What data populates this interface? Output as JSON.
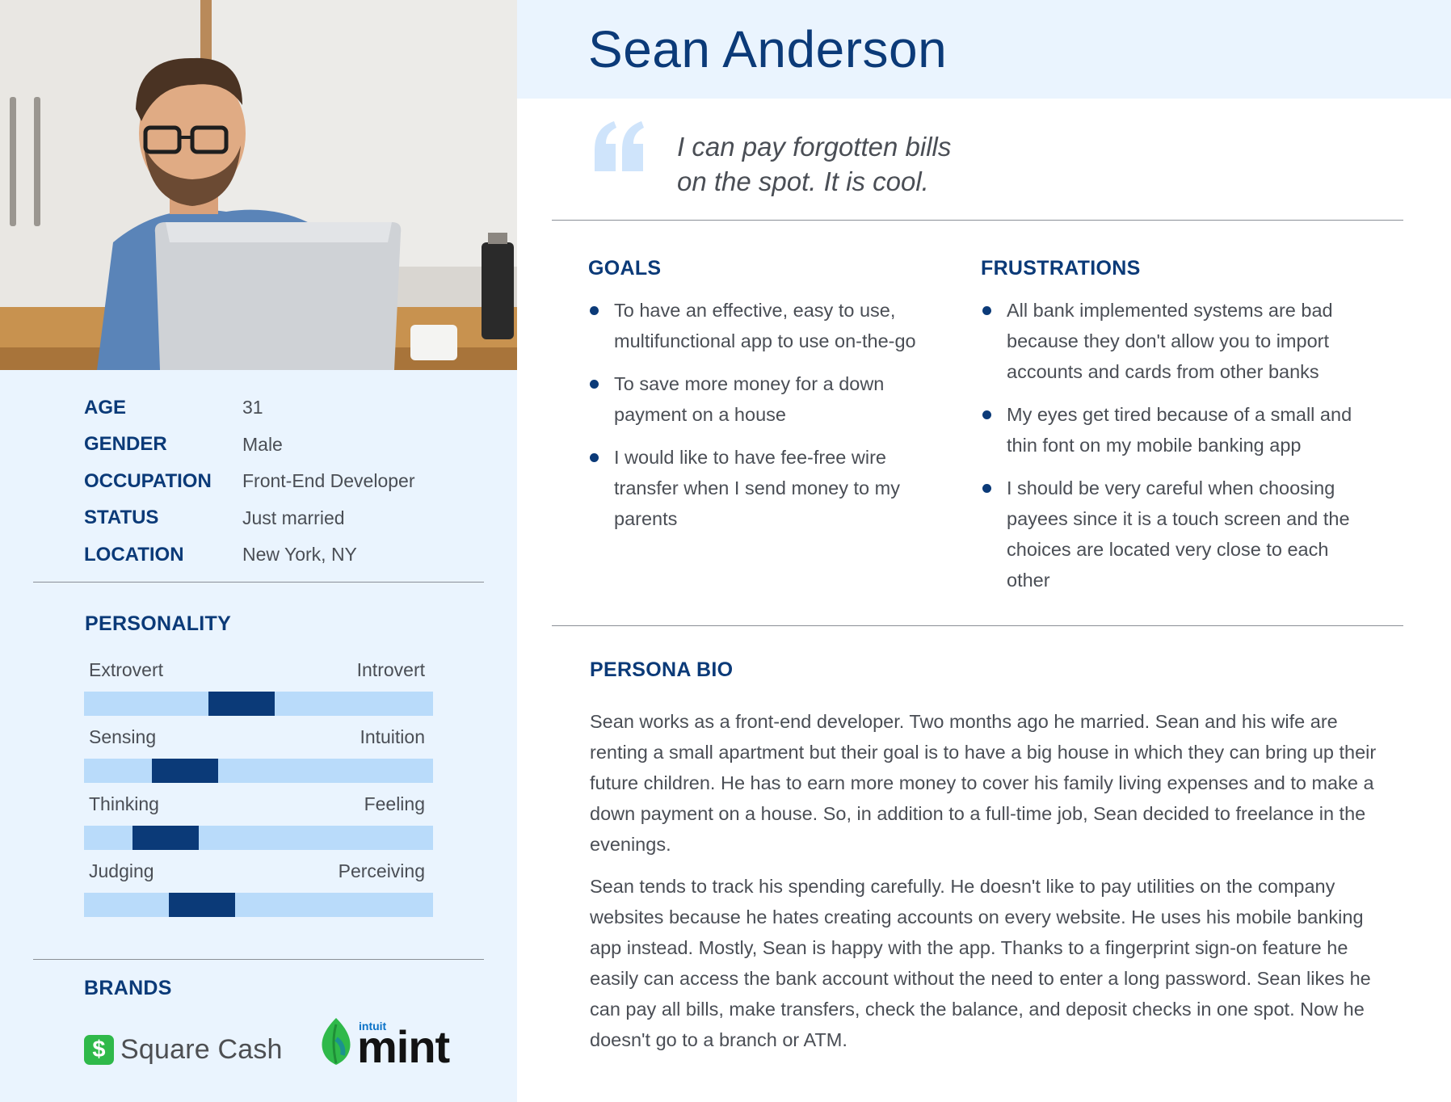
{
  "persona": {
    "name": "Sean Anderson",
    "quote_line1": "I can pay forgotten bills",
    "quote_line2": "on the spot. It is cool."
  },
  "profile": {
    "rows": [
      {
        "label": "AGE",
        "value": "31"
      },
      {
        "label": "GENDER",
        "value": "Male"
      },
      {
        "label": "OCCUPATION",
        "value": "Front-End Developer"
      },
      {
        "label": "STATUS",
        "value": "Just married"
      },
      {
        "label": "LOCATION",
        "value": "New York, NY"
      }
    ]
  },
  "personality": {
    "title": "PERSONALITY",
    "traits": [
      {
        "left": "Extrovert",
        "right": "Introvert",
        "position_fraction": 0.44
      },
      {
        "left": "Sensing",
        "right": "Intuition",
        "position_fraction": 0.24
      },
      {
        "left": "Thinking",
        "right": "Feeling",
        "position_fraction": 0.17
      },
      {
        "left": "Judging",
        "right": "Perceiving",
        "position_fraction": 0.3
      }
    ]
  },
  "brands": {
    "title": "BRANDS",
    "square_cash": {
      "icon": "dollar-sign-icon",
      "label": "Square Cash",
      "color": "#2fb94a"
    },
    "mint": {
      "small": "intuit",
      "label": "mint",
      "color": "#2fb94a"
    }
  },
  "goals": {
    "title": "GOALS",
    "items": [
      "To have an effective, easy to use, multifunctional app to use on-the-go",
      "To save more money for a down payment on a house",
      "I would like to have fee-free wire transfer when I send money to my parents"
    ]
  },
  "frustrations": {
    "title": "FRUSTRATIONS",
    "items": [
      "All bank implemented systems are bad because they don't allow you to import accounts and cards from other banks",
      "My eyes get tired because of a small and thin font on my mobile banking app",
      "I should be very careful when choosing payees since it is a touch screen and the choices are located very close to each other"
    ]
  },
  "bio": {
    "title": "PERSONA BIO",
    "paragraphs": [
      "Sean works as a front-end developer. Two months ago he married. Sean and his wife are renting a small apartment but their goal is to have a big house in which they can bring up their future children. He has to earn more money to cover his family living expenses and to make a down payment on a house. So, in addition to a full-time job, Sean decided to freelance in the evenings.",
      "Sean tends to track his spending carefully. He doesn't like to pay utilities on the company websites because he hates creating accounts on every website. He uses his mobile banking app instead. Mostly, Sean is happy with the app. Thanks to a fingerprint sign-on feature he easily can access the bank account without the need to enter a long password. Sean likes he can pay all bills, make transfers, check the balance, and deposit checks in one spot. Now he doesn't go to a branch or ATM."
    ]
  },
  "colors": {
    "navy": "#0b3a78",
    "light_blue_bg": "#eaf4fe",
    "bar_track": "#b9dbfa",
    "quote_mark": "#cfe4fb"
  }
}
